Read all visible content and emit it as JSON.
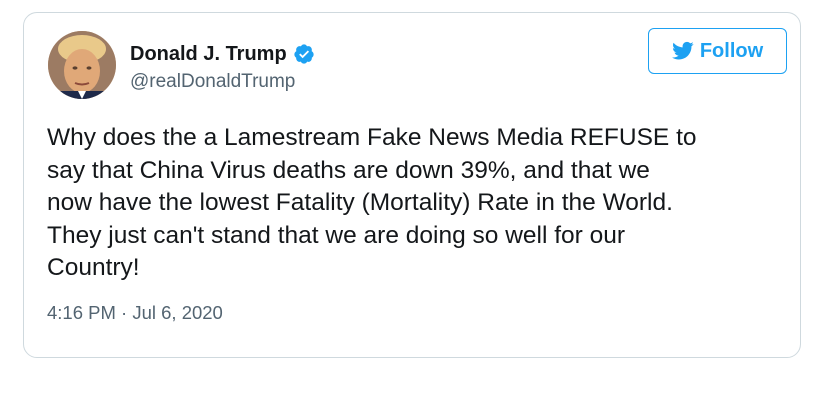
{
  "tweet": {
    "author": {
      "display_name": "Donald J. Trump",
      "handle": "@realDonaldTrump",
      "verified": true
    },
    "follow_label": "Follow",
    "text": "Why does the a Lamestream Fake News Media REFUSE to\nsay that China Virus deaths are down 39%, and that we\nnow have the lowest Fatality (Mortality) Rate in the World.\nThey just can't stand that we are doing so well for our\nCountry!",
    "timestamp": "4:16 PM · Jul 6, 2020"
  },
  "colors": {
    "accent": "#1da1f2",
    "text_primary": "#14171a",
    "text_secondary": "#536471",
    "border": "#cfd9de"
  },
  "icons": {
    "verified": "verified-badge-icon",
    "follow": "twitter-bird-icon"
  }
}
